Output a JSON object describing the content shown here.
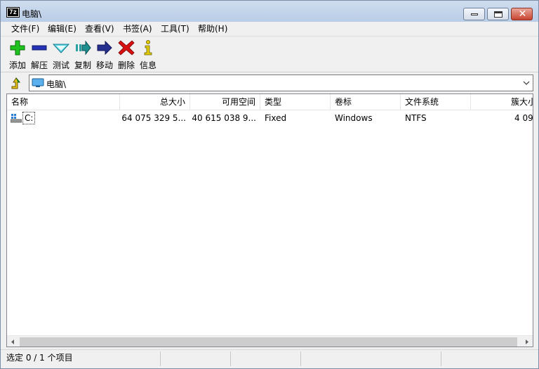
{
  "window": {
    "app_icon_text": "7z",
    "title": "电脑\\"
  },
  "menu": [
    "文件(F)",
    "编辑(E)",
    "查看(V)",
    "书签(A)",
    "工具(T)",
    "帮助(H)"
  ],
  "toolbar": [
    {
      "label": "添加",
      "icon": "add-icon",
      "color": "#19b019"
    },
    {
      "label": "解压",
      "icon": "extract-icon",
      "color": "#1f2fa8"
    },
    {
      "label": "测试",
      "icon": "test-icon",
      "color": "#1aa6b8"
    },
    {
      "label": "复制",
      "icon": "copy-icon",
      "color": "#1a8f8f"
    },
    {
      "label": "移动",
      "icon": "move-icon",
      "color": "#1f2a9a"
    },
    {
      "label": "删除",
      "icon": "delete-icon",
      "color": "#d01010"
    },
    {
      "label": "信息",
      "icon": "info-icon",
      "color": "#d8c300"
    }
  ],
  "address": {
    "path": "电脑\\",
    "icon": "computer-icon"
  },
  "columns": [
    "名称",
    "总大小",
    "可用空间",
    "类型",
    "卷标",
    "文件系统",
    "簇大小"
  ],
  "rows": [
    {
      "name": "C:",
      "icon": "drive-icon",
      "total_size": "64 075 329 5...",
      "free_space": "40 615 038 9...",
      "type": "Fixed",
      "label": "Windows",
      "filesystem": "NTFS",
      "cluster_size": "4 09"
    }
  ],
  "status": {
    "selection": "选定 0 / 1 个项目"
  }
}
